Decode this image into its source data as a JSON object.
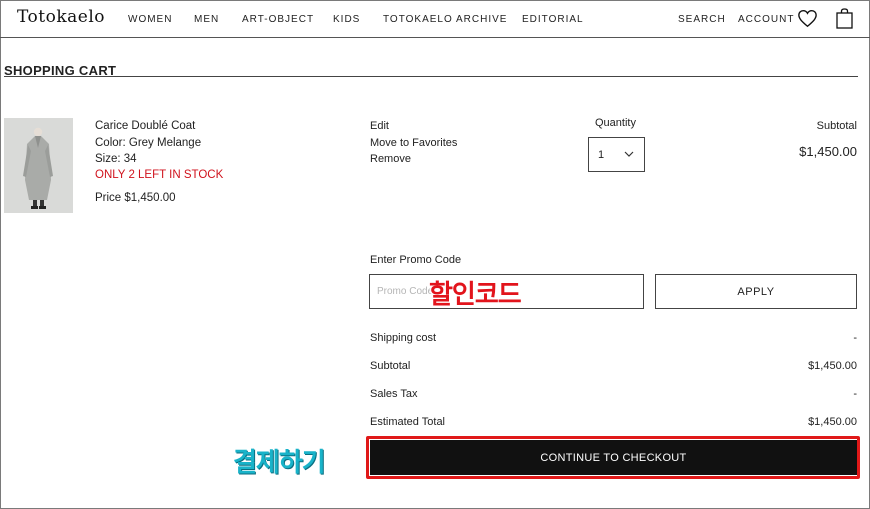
{
  "header": {
    "logo": "Totokaelo",
    "nav": [
      "WOMEN",
      "MEN",
      "ART-OBJECT",
      "KIDS",
      "TOTOKAELO ARCHIVE",
      "EDITORIAL"
    ],
    "search": "SEARCH",
    "account": "ACCOUNT",
    "icons": [
      "heart-icon",
      "shopping-bag-icon"
    ]
  },
  "page": {
    "title": "SHOPPING CART"
  },
  "item": {
    "name": "Carice Doublé Coat",
    "color": "Color: Grey Melange",
    "size": "Size: 34",
    "stock": "ONLY 2 LEFT IN STOCK",
    "price": "Price $1,450.00",
    "actions": [
      "Edit",
      "Move to Favorites",
      "Remove"
    ],
    "quantity_label": "Quantity",
    "quantity": "1",
    "subtotal_label": "Subtotal",
    "subtotal": "$1,450.00"
  },
  "promo": {
    "label": "Enter Promo Code",
    "placeholder": "Promo Code",
    "apply": "APPLY"
  },
  "summary": [
    {
      "label": "Shipping cost",
      "value": "-"
    },
    {
      "label": "Subtotal",
      "value": "$1,450.00"
    },
    {
      "label": "Sales Tax",
      "value": "-"
    },
    {
      "label": "Estimated Total",
      "value": "$1,450.00"
    }
  ],
  "checkout": "CONTINUE TO CHECKOUT",
  "annotations": {
    "promo": "할인코드",
    "checkout": "결제하기"
  },
  "colors": {
    "stock": "#d0121c",
    "button": "#111111",
    "highlight": "#e01818",
    "annotation_red": "#e2141c",
    "annotation_teal": "#19b3c9"
  }
}
